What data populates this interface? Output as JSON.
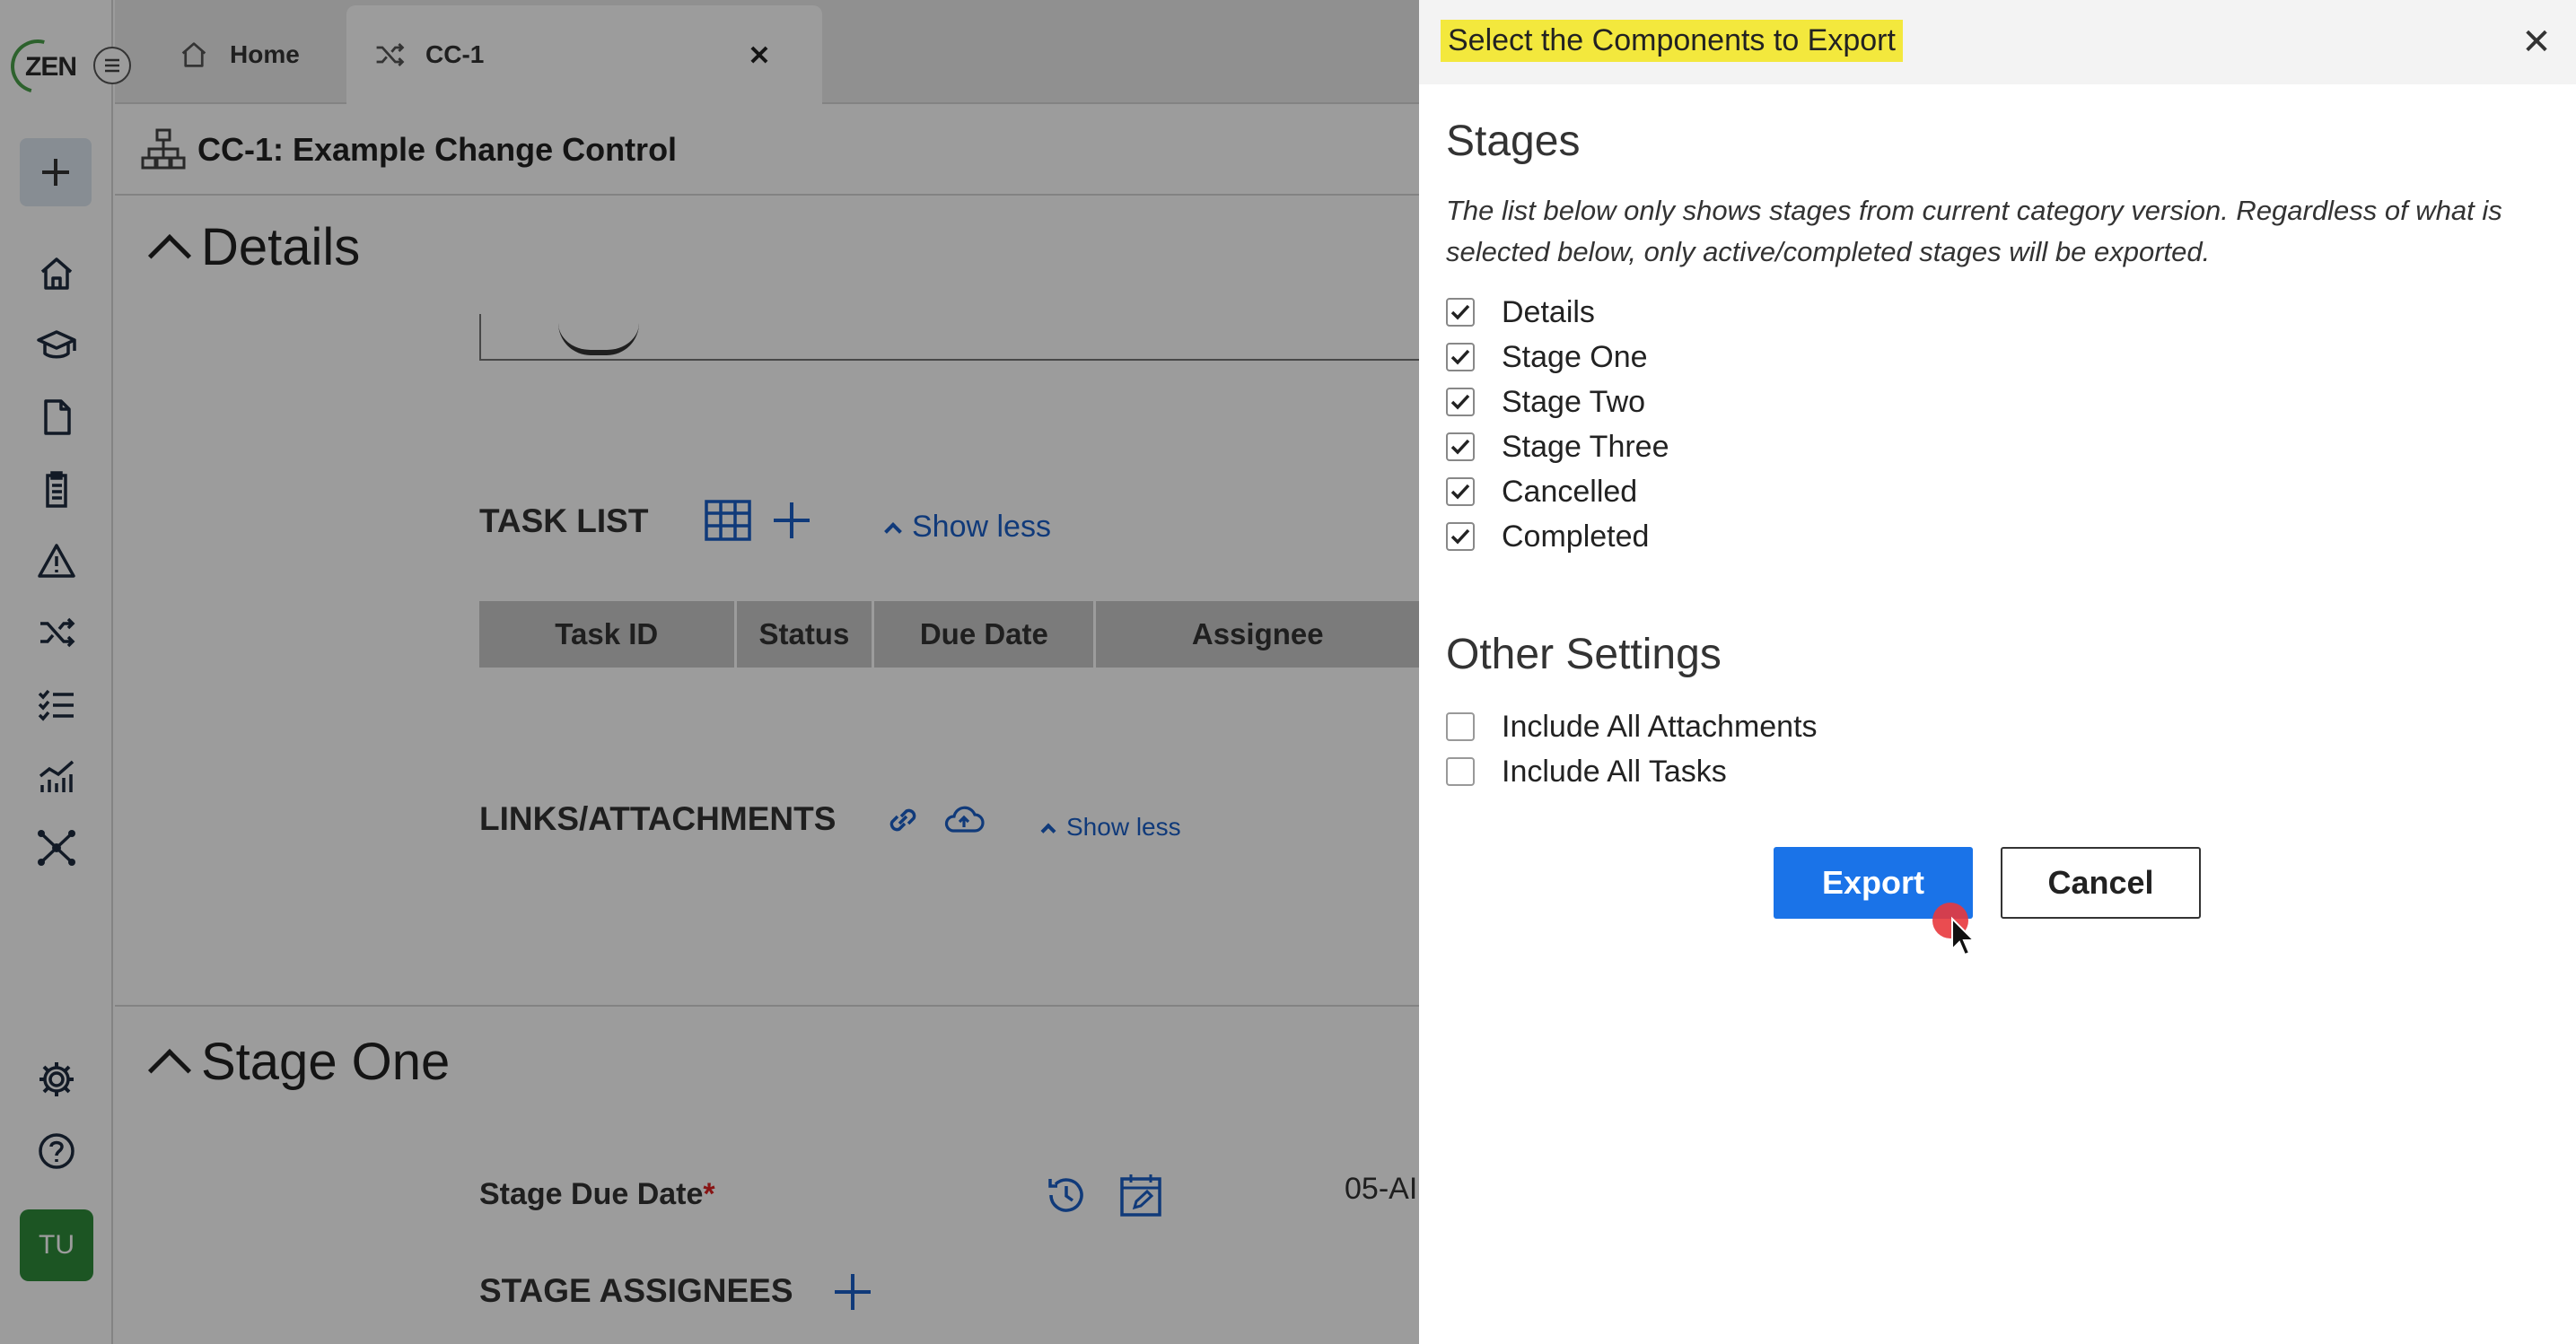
{
  "sidebar": {
    "logo_text": "ZEN",
    "avatar_initials": "TU",
    "icons": [
      "home-icon",
      "graduation-cap-icon",
      "document-icon",
      "clipboard-icon",
      "warning-icon",
      "shuffle-icon",
      "checklist-icon",
      "analytics-icon",
      "network-icon",
      "gear-icon",
      "help-icon"
    ]
  },
  "tabs": [
    {
      "label": "Home",
      "icon": "home-icon"
    },
    {
      "label": "CC-1",
      "icon": "shuffle-icon"
    }
  ],
  "page": {
    "title": "CC-1: Example Change Control"
  },
  "details": {
    "heading": "Details",
    "task_list_label": "TASK LIST",
    "show_less": "Show less",
    "task_columns": [
      "Task ID",
      "Status",
      "Due Date",
      "Assignee"
    ],
    "links_label": "LINKS/ATTACHMENTS",
    "links_show_less": "Show less"
  },
  "stage_one": {
    "heading": "Stage One",
    "due_date_label": "Stage Due Date",
    "required_mark": "*",
    "due_date_value": "05-AI",
    "assignees_label": "STAGE ASSIGNEES"
  },
  "modal": {
    "title": "Select the Components to Export",
    "stages_heading": "Stages",
    "stages_note": "The list below only shows stages from current category version. Regardless of what is selected below, only active/completed stages will be exported.",
    "stages": [
      {
        "label": "Details",
        "checked": true
      },
      {
        "label": "Stage One",
        "checked": true
      },
      {
        "label": "Stage Two",
        "checked": true
      },
      {
        "label": "Stage Three",
        "checked": true
      },
      {
        "label": "Cancelled",
        "checked": true
      },
      {
        "label": "Completed",
        "checked": true
      }
    ],
    "other_heading": "Other Settings",
    "other": [
      {
        "label": "Include All Attachments",
        "checked": false
      },
      {
        "label": "Include All Tasks",
        "checked": false
      }
    ],
    "export_label": "Export",
    "cancel_label": "Cancel"
  },
  "colors": {
    "accent": "#1a73e8",
    "link": "#1b5fc7",
    "highlight": "#f3e83d",
    "avatar": "#2e8b3a"
  }
}
